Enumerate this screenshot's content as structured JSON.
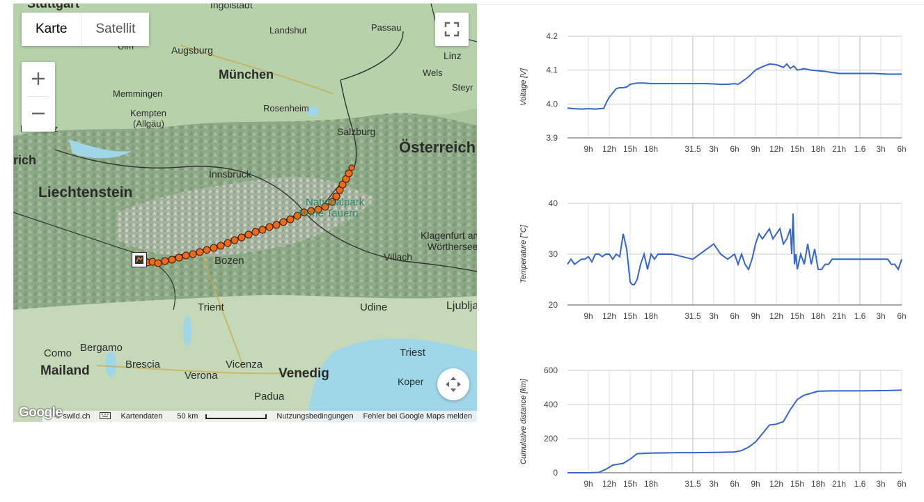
{
  "map": {
    "type_tabs": [
      {
        "label": "Karte",
        "active": true
      },
      {
        "label": "Satellit",
        "active": false
      }
    ],
    "zoom_in": "+",
    "zoom_out": "−",
    "labels": [
      {
        "text": "Stuttgart",
        "cls": "city"
      },
      {
        "text": "Ingolstadt",
        "cls": "city"
      },
      {
        "text": "Landshut",
        "cls": "town"
      },
      {
        "text": "Passau",
        "cls": "town"
      },
      {
        "text": "Ulm",
        "cls": "town"
      },
      {
        "text": "Augsburg",
        "cls": "city"
      },
      {
        "text": "München",
        "cls": "big"
      },
      {
        "text": "Linz",
        "cls": "city"
      },
      {
        "text": "Wels",
        "cls": "town"
      },
      {
        "text": "Memmingen",
        "cls": "town"
      },
      {
        "text": "Steyr",
        "cls": "town"
      },
      {
        "text": "Rosenheim",
        "cls": "town"
      },
      {
        "text": "Kempten",
        "cls": "town"
      },
      {
        "text": "(Allgäu)",
        "cls": "town"
      },
      {
        "text": "Konstanz",
        "cls": "town"
      },
      {
        "text": "Salzburg",
        "cls": "city"
      },
      {
        "text": "Österreich",
        "cls": "country"
      },
      {
        "text": "rich",
        "cls": "big"
      },
      {
        "text": "Innsbruck",
        "cls": "city"
      },
      {
        "text": "Liechtenstein",
        "cls": "country"
      },
      {
        "text": "Nationalpark",
        "cls": "park"
      },
      {
        "text": "Hohe Tauern",
        "cls": "park"
      },
      {
        "text": "Klagenfurt am",
        "cls": "town"
      },
      {
        "text": "Wörthersee",
        "cls": "town"
      },
      {
        "text": "Villach",
        "cls": "town"
      },
      {
        "text": "Bozen",
        "cls": "city"
      },
      {
        "text": "Trient",
        "cls": "city"
      },
      {
        "text": "Udine",
        "cls": "city"
      },
      {
        "text": "Ljublja",
        "cls": "city"
      },
      {
        "text": "Bergamo",
        "cls": "city"
      },
      {
        "text": "Como",
        "cls": "city"
      },
      {
        "text": "Mailand",
        "cls": "big"
      },
      {
        "text": "Brescia",
        "cls": "city"
      },
      {
        "text": "Verona",
        "cls": "city"
      },
      {
        "text": "Vicenza",
        "cls": "city"
      },
      {
        "text": "Venedig",
        "cls": "big"
      },
      {
        "text": "Triest",
        "cls": "city"
      },
      {
        "text": "Koper",
        "cls": "town"
      },
      {
        "text": "Padua",
        "cls": "city"
      }
    ],
    "attribution": {
      "google": "Google",
      "copyright": "© swild.ch",
      "map_data": "Kartendaten",
      "scale": "50 km",
      "terms": "Nutzungsbedingungen",
      "report": "Fehler bei Google Maps melden"
    }
  },
  "charts": {
    "x_ticks": [
      "9h",
      "12h",
      "15h",
      "18h",
      "31.5",
      "3h",
      "6h",
      "9h",
      "12h",
      "15h",
      "18h",
      "21h",
      "1.6",
      "3h",
      "6h"
    ],
    "x_tick_hours": [
      9,
      12,
      15,
      18,
      24,
      27,
      30,
      33,
      36,
      39,
      42,
      45,
      48,
      51,
      54
    ],
    "x_range_hours": [
      6,
      54
    ],
    "gridline_hours": [
      9,
      12,
      15,
      18,
      21,
      24,
      27,
      30,
      33,
      36,
      39,
      42,
      45,
      48,
      51,
      54
    ],
    "major_gridline_hours": [
      24,
      48
    ],
    "line_color": "#3366cc"
  },
  "chart_data": [
    {
      "type": "line",
      "ylabel": "Voltage [V]",
      "ylim": [
        3.9,
        4.2
      ],
      "yticks": [
        "4.2",
        "4.1",
        "4.0",
        "3.9"
      ],
      "ytick_values": [
        4.2,
        4.1,
        4.0,
        3.9
      ],
      "x_unit": "hours since 30.5 00:00",
      "series": [
        {
          "x": [
            6,
            7,
            8,
            9,
            10,
            10.5,
            11.2,
            11.6,
            12,
            12.6,
            13,
            13.5,
            14,
            14.5,
            15,
            16,
            17,
            18,
            19,
            20,
            22,
            24,
            26,
            28,
            29,
            30,
            30.5,
            31,
            32,
            33,
            33.5,
            34,
            35,
            36,
            36.5,
            37,
            37.5,
            38,
            38.5,
            39,
            40,
            41,
            42,
            43,
            44,
            45,
            46,
            48,
            50,
            52,
            53,
            54
          ],
          "y": [
            3.988,
            3.986,
            3.985,
            3.986,
            3.985,
            3.986,
            3.987,
            4.005,
            4.02,
            4.035,
            4.045,
            4.048,
            4.048,
            4.05,
            4.058,
            4.062,
            4.062,
            4.06,
            4.06,
            4.06,
            4.06,
            4.06,
            4.06,
            4.058,
            4.058,
            4.06,
            4.058,
            4.065,
            4.08,
            4.1,
            4.105,
            4.11,
            4.118,
            4.116,
            4.112,
            4.108,
            4.118,
            4.105,
            4.112,
            4.1,
            4.104,
            4.1,
            4.098,
            4.096,
            4.093,
            4.09,
            4.09,
            4.09,
            4.09,
            4.088,
            4.088,
            4.088
          ]
        }
      ]
    },
    {
      "type": "line",
      "ylabel": "Temperature [°C]",
      "ylim": [
        20,
        40
      ],
      "yticks": [
        "40",
        "30",
        "20"
      ],
      "ytick_values": [
        40,
        30,
        20
      ],
      "x_unit": "hours since 30.5 00:00",
      "series": [
        {
          "x": [
            6,
            6.5,
            7,
            7.5,
            8,
            8.5,
            9,
            9.5,
            10,
            10.5,
            11,
            11.5,
            12,
            12.5,
            13,
            13.5,
            14,
            14.5,
            15,
            15.3,
            15.6,
            16,
            16.5,
            17,
            17.5,
            18,
            18.5,
            19,
            21,
            24,
            26,
            27,
            27.5,
            28,
            29,
            30,
            30.5,
            31,
            31.5,
            32,
            32.5,
            33,
            33.5,
            34,
            35,
            35.5,
            36,
            36.5,
            37,
            37.5,
            38,
            38.2,
            38.4,
            38.6,
            38.8,
            39,
            39.5,
            40,
            40.5,
            41,
            41.5,
            42,
            42.5,
            43,
            43.5,
            44,
            45,
            48,
            52,
            52.5,
            53,
            53.5,
            54
          ],
          "y": [
            28,
            29,
            28,
            28.5,
            29,
            29,
            29.5,
            28.5,
            30,
            30,
            29.5,
            30,
            30,
            29,
            30,
            29.5,
            34,
            31,
            24.5,
            24,
            24,
            25,
            28,
            30,
            27,
            30,
            29,
            30,
            30,
            29,
            31,
            32,
            31,
            30,
            29,
            30,
            28,
            30,
            28,
            27,
            29,
            32,
            34,
            33,
            35,
            33,
            34,
            35,
            32,
            33,
            35,
            30,
            38,
            28,
            30,
            27,
            30,
            28,
            32,
            28,
            31,
            27,
            27,
            28,
            28,
            29,
            29,
            29,
            29,
            28,
            28,
            27,
            29
          ]
        }
      ]
    },
    {
      "type": "line",
      "ylabel": "Cumulative distance [km]",
      "ylim": [
        0,
        600
      ],
      "yticks": [
        "600",
        "400",
        "200",
        "0"
      ],
      "ytick_values": [
        600,
        400,
        200,
        0
      ],
      "x_unit": "hours since 30.5 00:00",
      "series": [
        {
          "x": [
            6,
            9,
            10.5,
            11.5,
            12.5,
            14,
            15,
            16,
            18,
            22,
            24,
            28,
            30,
            31,
            32,
            33,
            34,
            35,
            36,
            37,
            38,
            39,
            40,
            42,
            44,
            48,
            52,
            54
          ],
          "y": [
            0,
            0,
            2,
            20,
            45,
            55,
            80,
            112,
            115,
            118,
            118,
            120,
            122,
            130,
            150,
            180,
            230,
            280,
            285,
            300,
            370,
            430,
            455,
            478,
            480,
            480,
            482,
            485
          ]
        }
      ]
    }
  ]
}
